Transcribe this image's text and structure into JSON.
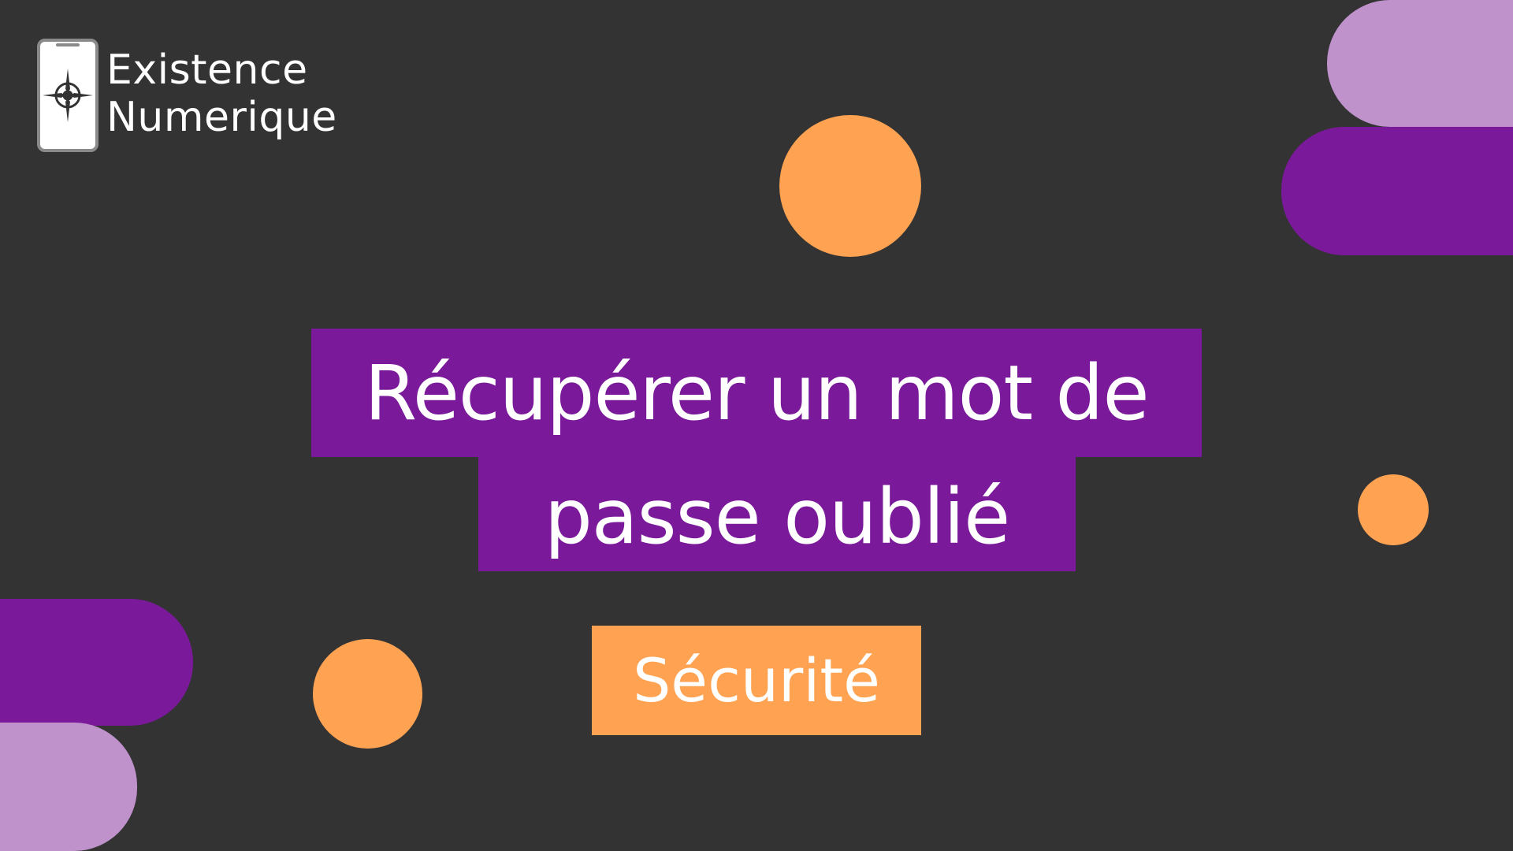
{
  "colors": {
    "background": "#333333",
    "purple": "#7a1a9a",
    "light_purple": "#bf92cc",
    "orange": "#ffa352",
    "text": "#ffffff"
  },
  "logo": {
    "icon": "phone-compass-icon",
    "line1": "Existence",
    "line2": "Numerique"
  },
  "title": {
    "line1": "Récupérer un mot de",
    "line2": "passe oublié"
  },
  "category": {
    "label": "Sécurité"
  }
}
